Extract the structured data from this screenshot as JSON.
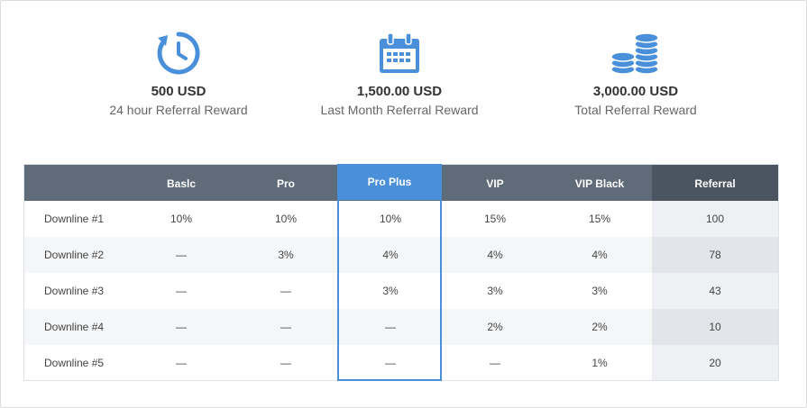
{
  "stats": [
    {
      "icon": "clock-refresh-icon",
      "amount": "500 USD",
      "label": "24 hour Referral Reward"
    },
    {
      "icon": "calendar-icon",
      "amount": "1,500.00 USD",
      "label": "Last Month Referral Reward"
    },
    {
      "icon": "coin-stacks-icon",
      "amount": "3,000.00 USD",
      "label": "Total Referral Reward"
    }
  ],
  "table": {
    "columns": [
      "",
      "Baslc",
      "Pro",
      "Pro Plus",
      "VIP",
      "VIP Black",
      "Referral"
    ],
    "highlighted_column": "Pro Plus",
    "rows": [
      [
        "Downline #1",
        "10%",
        "10%",
        "10%",
        "15%",
        "15%",
        "100"
      ],
      [
        "Downline #2",
        "—",
        "3%",
        "4%",
        "4%",
        "4%",
        "78"
      ],
      [
        "Downline #3",
        "—",
        "—",
        "3%",
        "3%",
        "3%",
        "43"
      ],
      [
        "Downline #4",
        "—",
        "—",
        "—",
        "2%",
        "2%",
        "10"
      ],
      [
        "Downline #5",
        "—",
        "—",
        "—",
        "—",
        "1%",
        "20"
      ]
    ]
  },
  "colors": {
    "accent": "#4a8fd9",
    "header": "#5f6b78",
    "header_dark": "#4b5561"
  }
}
